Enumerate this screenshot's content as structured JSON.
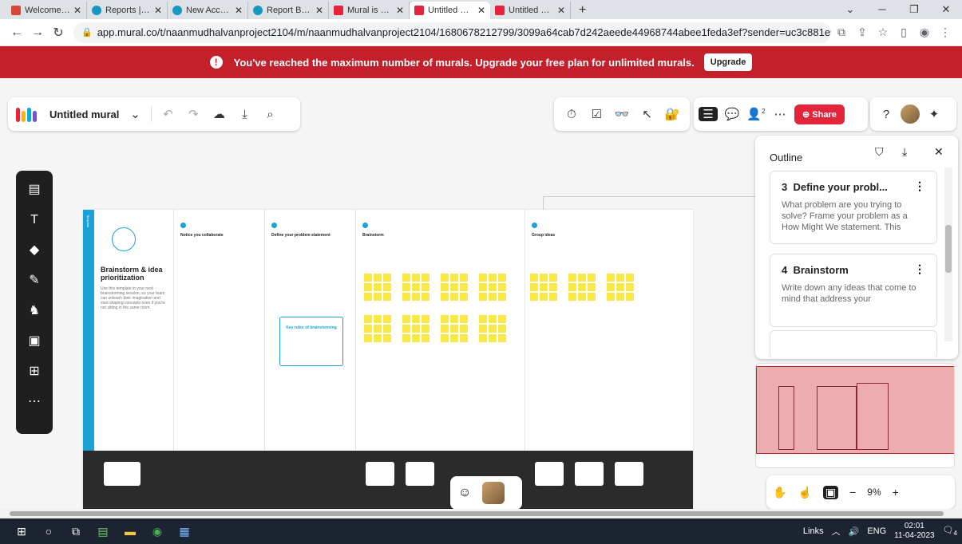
{
  "browser": {
    "tabs": [
      {
        "title": "Welcome to Salesforce",
        "favicon_color": "#d44638"
      },
      {
        "title": "Reports | Salesforce",
        "favicon_color": "#1798c1"
      },
      {
        "title": "New Accounts Report",
        "favicon_color": "#1798c1"
      },
      {
        "title": "Report Builder | Salesforce",
        "favicon_color": "#1798c1"
      },
      {
        "title": "Mural is a collaborative",
        "favicon_color": "#e3243b"
      },
      {
        "title": "Untitled mural - Mural",
        "favicon_color": "#e3243b",
        "active": true
      },
      {
        "title": "Untitled mural - Mural",
        "favicon_color": "#e3243b"
      }
    ],
    "new_tab_label": "+",
    "url": "app.mural.co/t/naanmudhalvanproject2104/m/naanmudhalvanproject2104/1680678212799/3099a64cab7d242aeede44968744abee1feda3ef?sender=uc3c881e9dc..."
  },
  "banner": {
    "message": "You've reached the maximum number of murals. Upgrade your free plan for unlimited murals.",
    "button": "Upgrade",
    "bg_color": "#c3202b"
  },
  "toolbar": {
    "mural_title": "Untitled mural",
    "share_label": "Share",
    "collaborator_count": "2",
    "accent": "#e3243b"
  },
  "board": {
    "template_label": "Template",
    "brainstorm_title": "Brainstorm & idea prioritization",
    "brainstorm_desc": "Use this template in your next brainstorming session, so your team can unleash their imagination and start shaping concepts even if you're not sitting in the same room.",
    "columns": [
      {
        "title": "Notice you collaborate"
      },
      {
        "title": "Define your problem statement"
      },
      {
        "title": "Brainstorm"
      },
      {
        "title": "Group ideas"
      }
    ],
    "key_rules_title": "Key rules of brainstorming"
  },
  "outline": {
    "title": "Outline",
    "items": [
      {
        "number": "3",
        "title": "Define your probl...",
        "desc": "What problem are you trying to solve? Frame your problem as a How Might We statement. This"
      },
      {
        "number": "4",
        "title": "Brainstorm",
        "desc": "Write down any ideas that come to mind that address your"
      }
    ]
  },
  "zoom": {
    "level": "9%",
    "minus": "−",
    "plus": "+"
  },
  "taskbar": {
    "links_label": "Links",
    "lang": "ENG",
    "time": "02:01",
    "date": "11-04-2023",
    "notifications": "4"
  }
}
